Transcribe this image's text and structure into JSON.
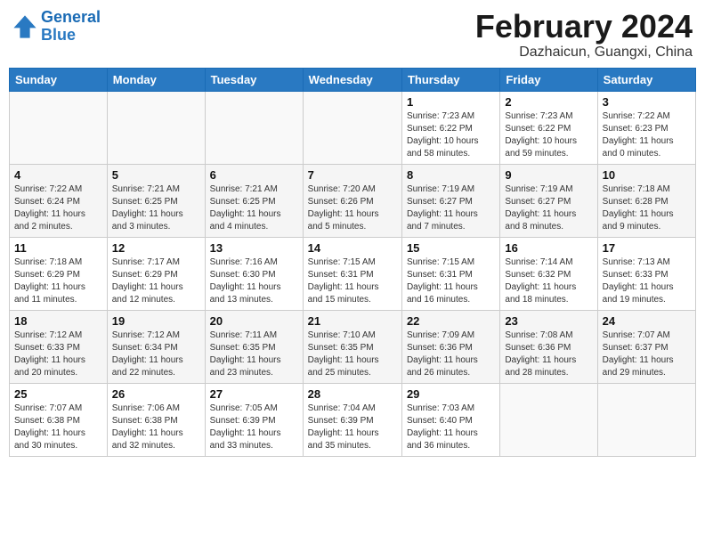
{
  "header": {
    "logo_line1": "General",
    "logo_line2": "Blue",
    "month_title": "February 2024",
    "subtitle": "Dazhaicun, Guangxi, China"
  },
  "weekdays": [
    "Sunday",
    "Monday",
    "Tuesday",
    "Wednesday",
    "Thursday",
    "Friday",
    "Saturday"
  ],
  "weeks": [
    [
      {
        "day": "",
        "info": ""
      },
      {
        "day": "",
        "info": ""
      },
      {
        "day": "",
        "info": ""
      },
      {
        "day": "",
        "info": ""
      },
      {
        "day": "1",
        "info": "Sunrise: 7:23 AM\nSunset: 6:22 PM\nDaylight: 10 hours\nand 58 minutes."
      },
      {
        "day": "2",
        "info": "Sunrise: 7:23 AM\nSunset: 6:22 PM\nDaylight: 10 hours\nand 59 minutes."
      },
      {
        "day": "3",
        "info": "Sunrise: 7:22 AM\nSunset: 6:23 PM\nDaylight: 11 hours\nand 0 minutes."
      }
    ],
    [
      {
        "day": "4",
        "info": "Sunrise: 7:22 AM\nSunset: 6:24 PM\nDaylight: 11 hours\nand 2 minutes."
      },
      {
        "day": "5",
        "info": "Sunrise: 7:21 AM\nSunset: 6:25 PM\nDaylight: 11 hours\nand 3 minutes."
      },
      {
        "day": "6",
        "info": "Sunrise: 7:21 AM\nSunset: 6:25 PM\nDaylight: 11 hours\nand 4 minutes."
      },
      {
        "day": "7",
        "info": "Sunrise: 7:20 AM\nSunset: 6:26 PM\nDaylight: 11 hours\nand 5 minutes."
      },
      {
        "day": "8",
        "info": "Sunrise: 7:19 AM\nSunset: 6:27 PM\nDaylight: 11 hours\nand 7 minutes."
      },
      {
        "day": "9",
        "info": "Sunrise: 7:19 AM\nSunset: 6:27 PM\nDaylight: 11 hours\nand 8 minutes."
      },
      {
        "day": "10",
        "info": "Sunrise: 7:18 AM\nSunset: 6:28 PM\nDaylight: 11 hours\nand 9 minutes."
      }
    ],
    [
      {
        "day": "11",
        "info": "Sunrise: 7:18 AM\nSunset: 6:29 PM\nDaylight: 11 hours\nand 11 minutes."
      },
      {
        "day": "12",
        "info": "Sunrise: 7:17 AM\nSunset: 6:29 PM\nDaylight: 11 hours\nand 12 minutes."
      },
      {
        "day": "13",
        "info": "Sunrise: 7:16 AM\nSunset: 6:30 PM\nDaylight: 11 hours\nand 13 minutes."
      },
      {
        "day": "14",
        "info": "Sunrise: 7:15 AM\nSunset: 6:31 PM\nDaylight: 11 hours\nand 15 minutes."
      },
      {
        "day": "15",
        "info": "Sunrise: 7:15 AM\nSunset: 6:31 PM\nDaylight: 11 hours\nand 16 minutes."
      },
      {
        "day": "16",
        "info": "Sunrise: 7:14 AM\nSunset: 6:32 PM\nDaylight: 11 hours\nand 18 minutes."
      },
      {
        "day": "17",
        "info": "Sunrise: 7:13 AM\nSunset: 6:33 PM\nDaylight: 11 hours\nand 19 minutes."
      }
    ],
    [
      {
        "day": "18",
        "info": "Sunrise: 7:12 AM\nSunset: 6:33 PM\nDaylight: 11 hours\nand 20 minutes."
      },
      {
        "day": "19",
        "info": "Sunrise: 7:12 AM\nSunset: 6:34 PM\nDaylight: 11 hours\nand 22 minutes."
      },
      {
        "day": "20",
        "info": "Sunrise: 7:11 AM\nSunset: 6:35 PM\nDaylight: 11 hours\nand 23 minutes."
      },
      {
        "day": "21",
        "info": "Sunrise: 7:10 AM\nSunset: 6:35 PM\nDaylight: 11 hours\nand 25 minutes."
      },
      {
        "day": "22",
        "info": "Sunrise: 7:09 AM\nSunset: 6:36 PM\nDaylight: 11 hours\nand 26 minutes."
      },
      {
        "day": "23",
        "info": "Sunrise: 7:08 AM\nSunset: 6:36 PM\nDaylight: 11 hours\nand 28 minutes."
      },
      {
        "day": "24",
        "info": "Sunrise: 7:07 AM\nSunset: 6:37 PM\nDaylight: 11 hours\nand 29 minutes."
      }
    ],
    [
      {
        "day": "25",
        "info": "Sunrise: 7:07 AM\nSunset: 6:38 PM\nDaylight: 11 hours\nand 30 minutes."
      },
      {
        "day": "26",
        "info": "Sunrise: 7:06 AM\nSunset: 6:38 PM\nDaylight: 11 hours\nand 32 minutes."
      },
      {
        "day": "27",
        "info": "Sunrise: 7:05 AM\nSunset: 6:39 PM\nDaylight: 11 hours\nand 33 minutes."
      },
      {
        "day": "28",
        "info": "Sunrise: 7:04 AM\nSunset: 6:39 PM\nDaylight: 11 hours\nand 35 minutes."
      },
      {
        "day": "29",
        "info": "Sunrise: 7:03 AM\nSunset: 6:40 PM\nDaylight: 11 hours\nand 36 minutes."
      },
      {
        "day": "",
        "info": ""
      },
      {
        "day": "",
        "info": ""
      }
    ]
  ]
}
